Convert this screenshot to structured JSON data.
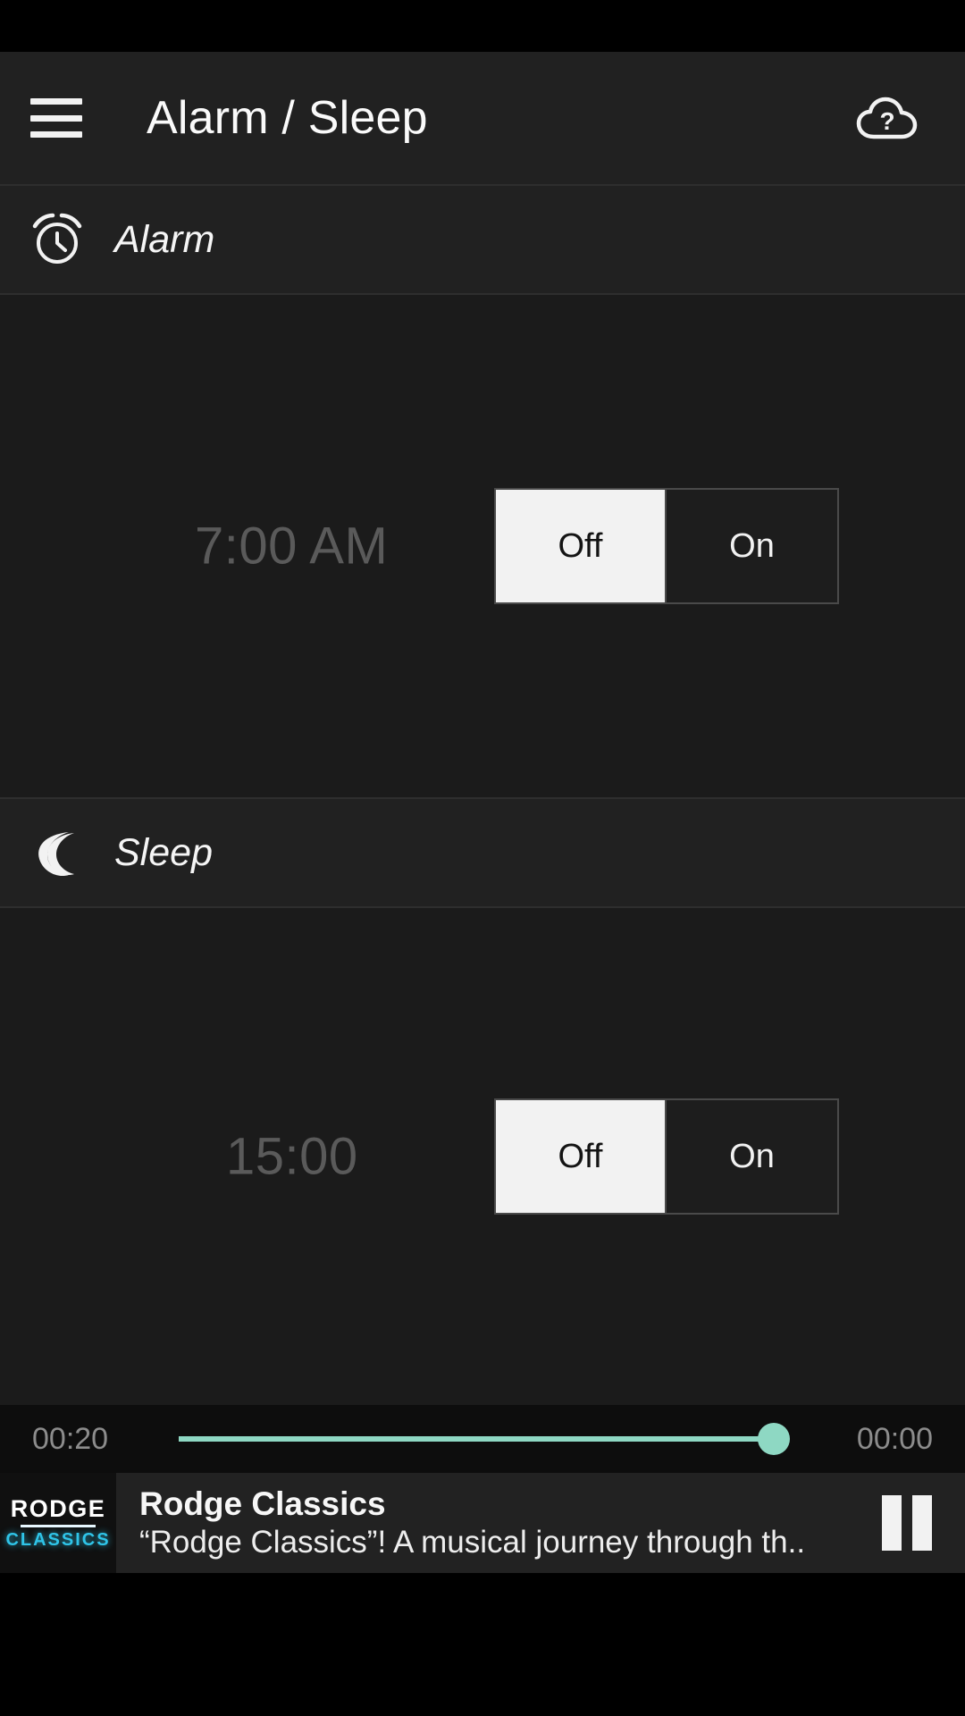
{
  "app": {
    "title": "Alarm / Sleep",
    "menu_icon": "hamburger-menu-icon",
    "help_icon": "cloud-question-icon"
  },
  "sections": [
    {
      "id": "alarm",
      "label": "Alarm",
      "icon": "alarm-clock-icon",
      "time_value": "7:00 AM",
      "toggle": {
        "options": [
          "Off",
          "On"
        ],
        "selected": "Off"
      }
    },
    {
      "id": "sleep",
      "label": "Sleep",
      "icon": "crescent-moon-icon",
      "time_value": "15:00",
      "toggle": {
        "options": [
          "Off",
          "On"
        ],
        "selected": "Off"
      }
    }
  ],
  "player": {
    "elapsed": "00:20",
    "remaining": "00:00",
    "progress_percent": 98,
    "station_title": "Rodge Classics",
    "station_description": "“Rodge Classics”! A musical journey through th..",
    "artwork": {
      "line1": "RODGE",
      "line2": "CLASSICS"
    },
    "transport_icon": "pause-icon",
    "transport_state": "playing"
  },
  "colors": {
    "accent_progress": "#8ed8c3",
    "artwork_accent": "#2fc4e8",
    "app_bar_bg": "#212121",
    "panel_bg": "#1b1b1b",
    "player_bar_bg": "#222222",
    "dim_text": "#5a5a5a"
  }
}
